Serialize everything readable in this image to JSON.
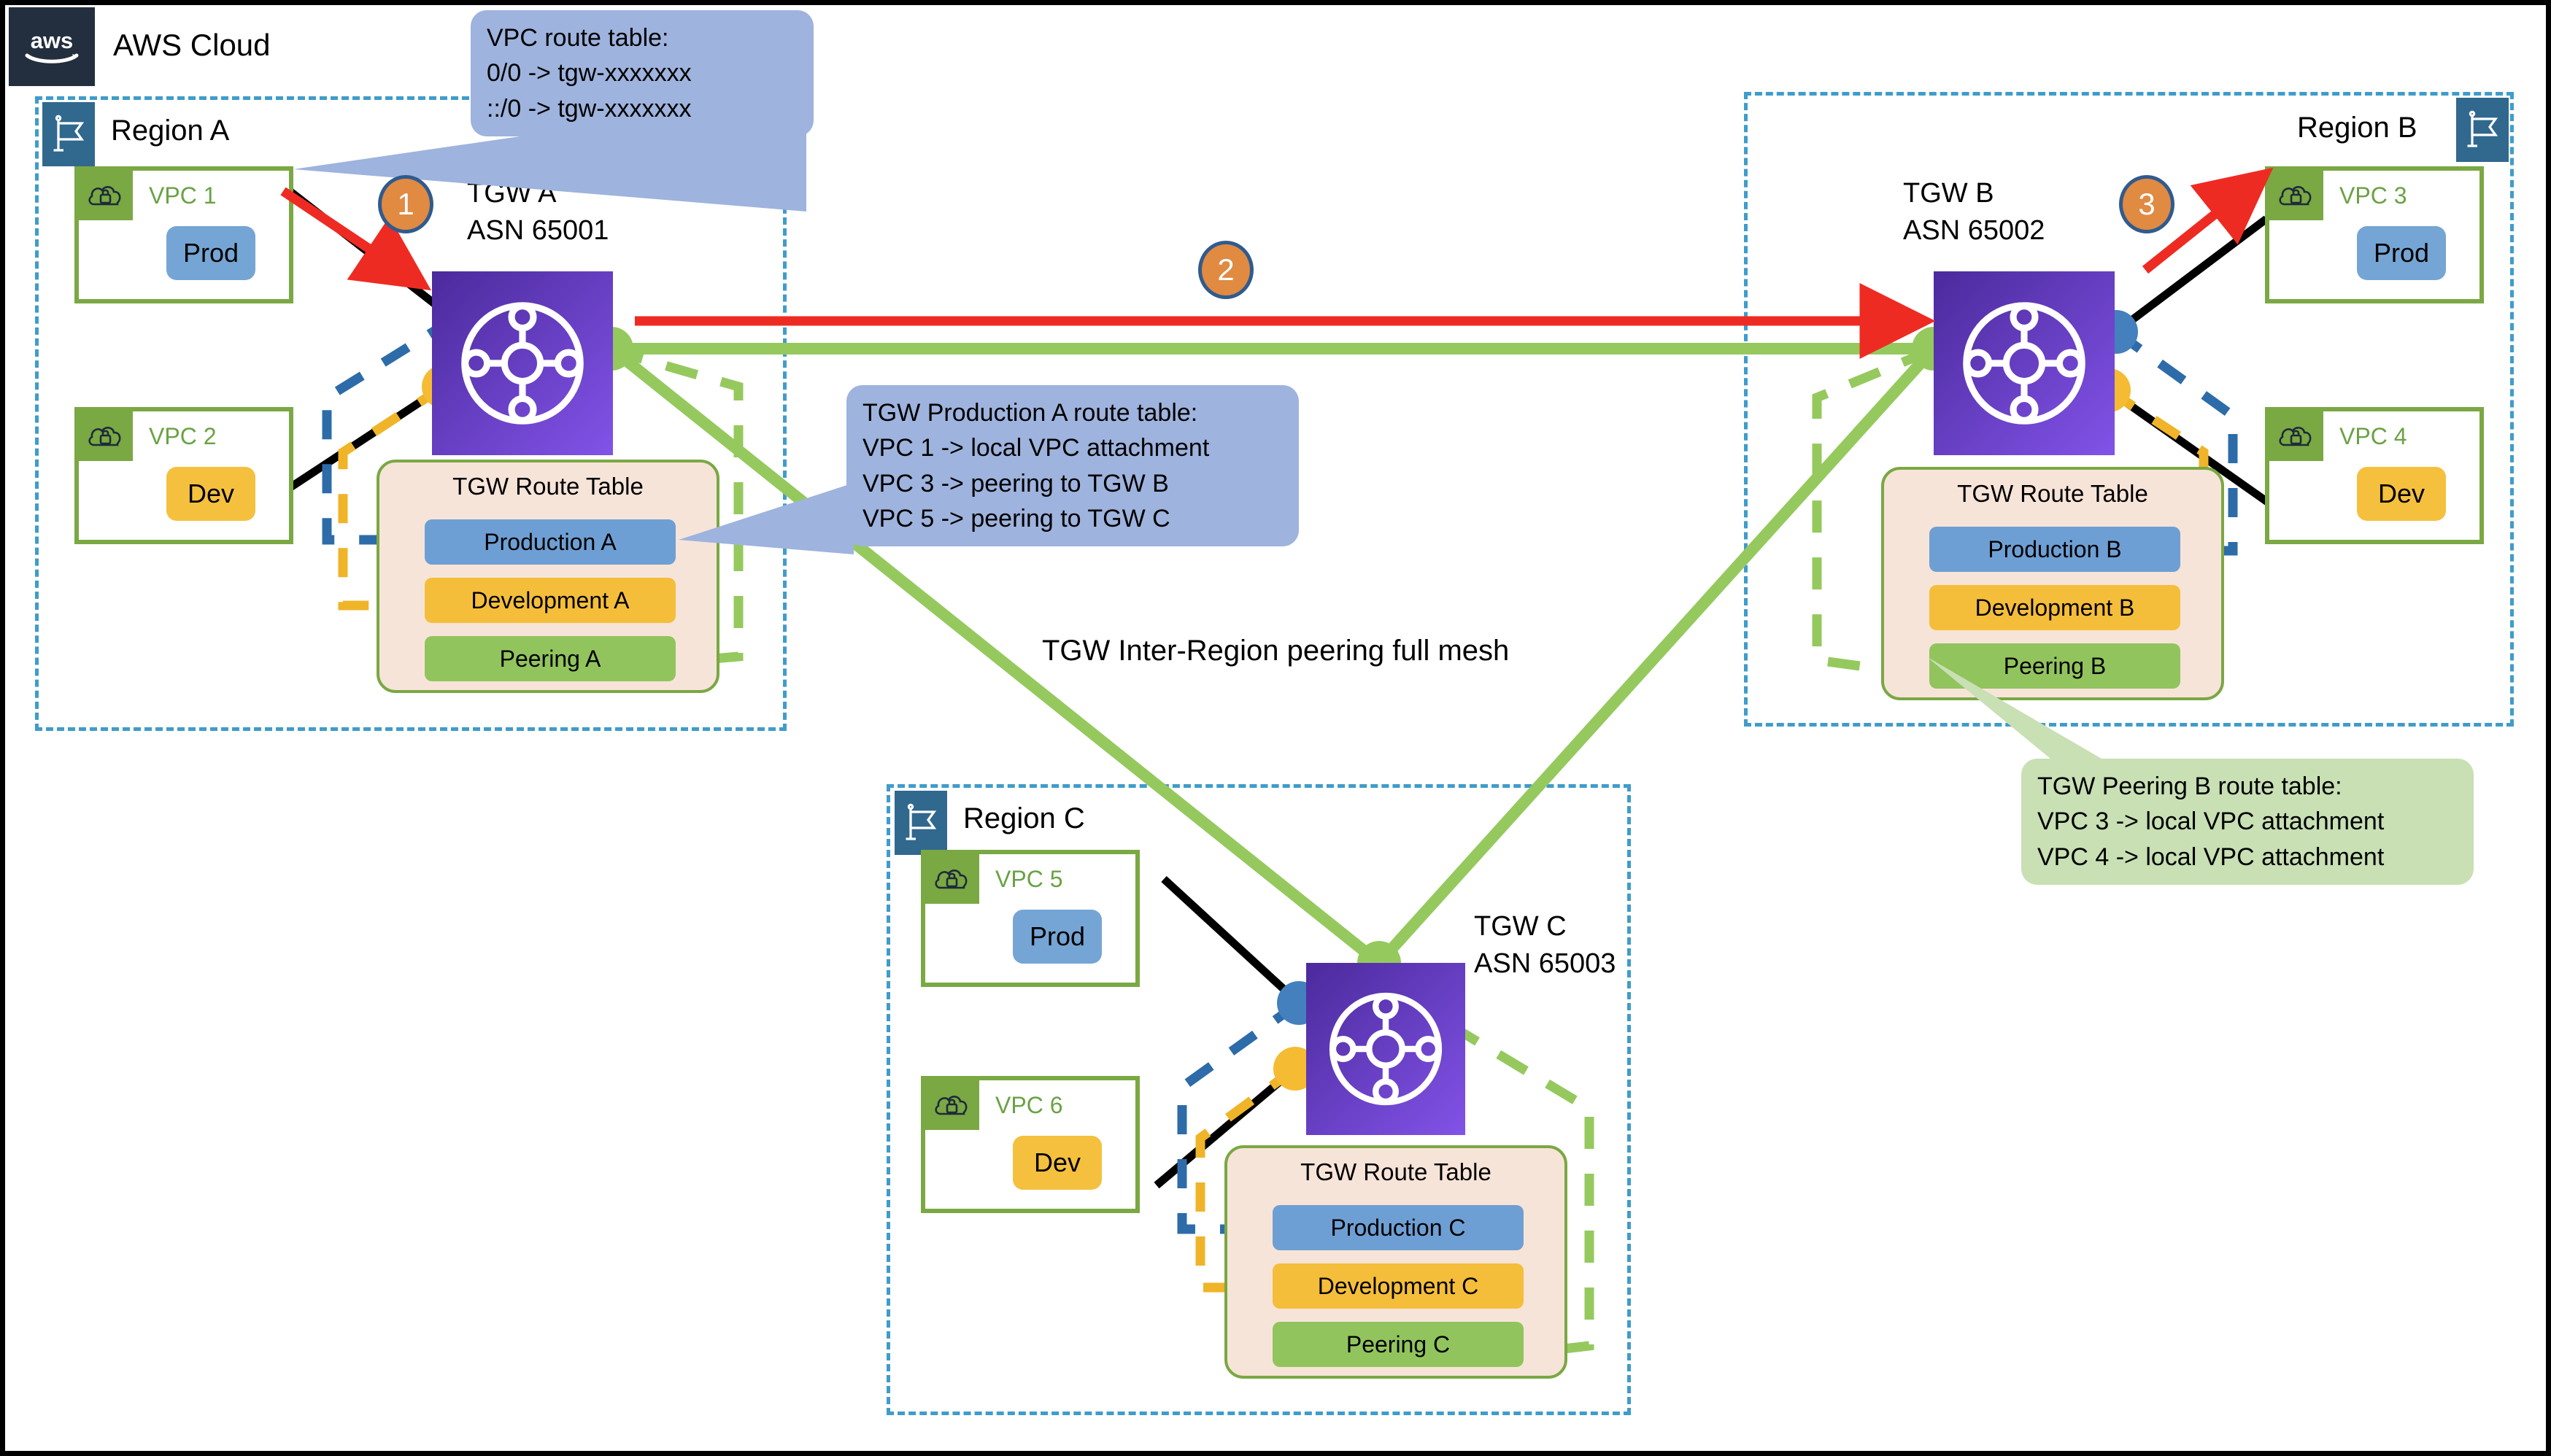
{
  "cloud": {
    "logo_icon": "aws-logo-icon",
    "title": "AWS Cloud"
  },
  "regions": [
    {
      "id": "a",
      "label": "Region A",
      "flag_icon": "region-flag-icon"
    },
    {
      "id": "b",
      "label": "Region B",
      "flag_icon": "region-flag-icon"
    },
    {
      "id": "c",
      "label": "Region C",
      "flag_icon": "region-flag-icon"
    }
  ],
  "vpcs": [
    {
      "id": "vpc1",
      "name": "VPC 1",
      "workload": "Prod",
      "kind": "prod",
      "icon": "vpc-cloud-lock-icon"
    },
    {
      "id": "vpc2",
      "name": "VPC 2",
      "workload": "Dev",
      "kind": "dev",
      "icon": "vpc-cloud-lock-icon"
    },
    {
      "id": "vpc3",
      "name": "VPC 3",
      "workload": "Prod",
      "kind": "prod",
      "icon": "vpc-cloud-lock-icon"
    },
    {
      "id": "vpc4",
      "name": "VPC 4",
      "workload": "Dev",
      "kind": "dev",
      "icon": "vpc-cloud-lock-icon"
    },
    {
      "id": "vpc5",
      "name": "VPC 5",
      "workload": "Prod",
      "kind": "prod",
      "icon": "vpc-cloud-lock-icon"
    },
    {
      "id": "vpc6",
      "name": "VPC 6",
      "workload": "Dev",
      "kind": "dev",
      "icon": "vpc-cloud-lock-icon"
    }
  ],
  "tgws": [
    {
      "id": "tgwa",
      "name": "TGW A",
      "asn": "ASN 65001",
      "icon": "transit-gateway-icon"
    },
    {
      "id": "tgwb",
      "name": "TGW B",
      "asn": "ASN 65002",
      "icon": "transit-gateway-icon"
    },
    {
      "id": "tgwc",
      "name": "TGW C",
      "asn": "ASN 65003",
      "icon": "transit-gateway-icon"
    }
  ],
  "route_tables": [
    {
      "id": "rta",
      "title": "TGW Route Table",
      "rows": [
        {
          "label": "Production A",
          "kind": "prod"
        },
        {
          "label": "Development A",
          "kind": "dev"
        },
        {
          "label": "Peering A",
          "kind": "peer"
        }
      ]
    },
    {
      "id": "rtb",
      "title": "TGW Route Table",
      "rows": [
        {
          "label": "Production B",
          "kind": "prod"
        },
        {
          "label": "Development B",
          "kind": "dev"
        },
        {
          "label": "Peering B",
          "kind": "peer"
        }
      ]
    },
    {
      "id": "rtc",
      "title": "TGW Route Table",
      "rows": [
        {
          "label": "Production C",
          "kind": "prod"
        },
        {
          "label": "Development C",
          "kind": "dev"
        },
        {
          "label": "Peering C",
          "kind": "peer"
        }
      ]
    }
  ],
  "callouts": [
    {
      "id": "vpc_rt",
      "style": "blue",
      "lines": [
        "VPC route table:",
        "0/0 -> tgw-xxxxxxx",
        "::/0 -> tgw-xxxxxxx"
      ]
    },
    {
      "id": "tgw_prod_a_rt",
      "style": "blue",
      "lines": [
        "TGW Production A route table:",
        "VPC 1 -> local VPC attachment",
        "VPC 3 -> peering to TGW B",
        "VPC 5 -> peering to TGW C"
      ]
    },
    {
      "id": "tgw_peering_b_rt",
      "style": "green",
      "lines": [
        "TGW Peering B route table:",
        "VPC 3 -> local VPC attachment",
        "VPC 4 -> local VPC attachment"
      ]
    }
  ],
  "steps": [
    {
      "id": "step1",
      "label": "1"
    },
    {
      "id": "step2",
      "label": "2"
    },
    {
      "id": "step3",
      "label": "3"
    }
  ],
  "annotations": {
    "mesh": "TGW Inter-Region peering full mesh"
  },
  "colors": {
    "aws_navy": "#232f3e",
    "region_dash": "#3f9ccb",
    "region_flag": "#31688e",
    "vpc_green": "#7aa843",
    "vpc_label_green": "#6aa244",
    "prod_blue": "#75a5d4",
    "dev_yellow": "#f5c03e",
    "tgw_purple_dark": "#4b2a9c",
    "tgw_purple_light": "#8253e8",
    "rt_card_bg": "#f7e4d8",
    "rt_prod": "#6e9fd4",
    "rt_dev": "#f5be3a",
    "rt_peer": "#92c45e",
    "callout_blue": "#9eb3dd",
    "callout_green": "#c8e0b4",
    "step_orange": "#e08a42",
    "step_ring": "#2f5b8e",
    "flow_red": "#ee2b22",
    "peering_green": "#95c95e",
    "attach_black": "#000000",
    "attach_blue": "#2d6ca8",
    "attach_yellow": "#f0b429"
  }
}
